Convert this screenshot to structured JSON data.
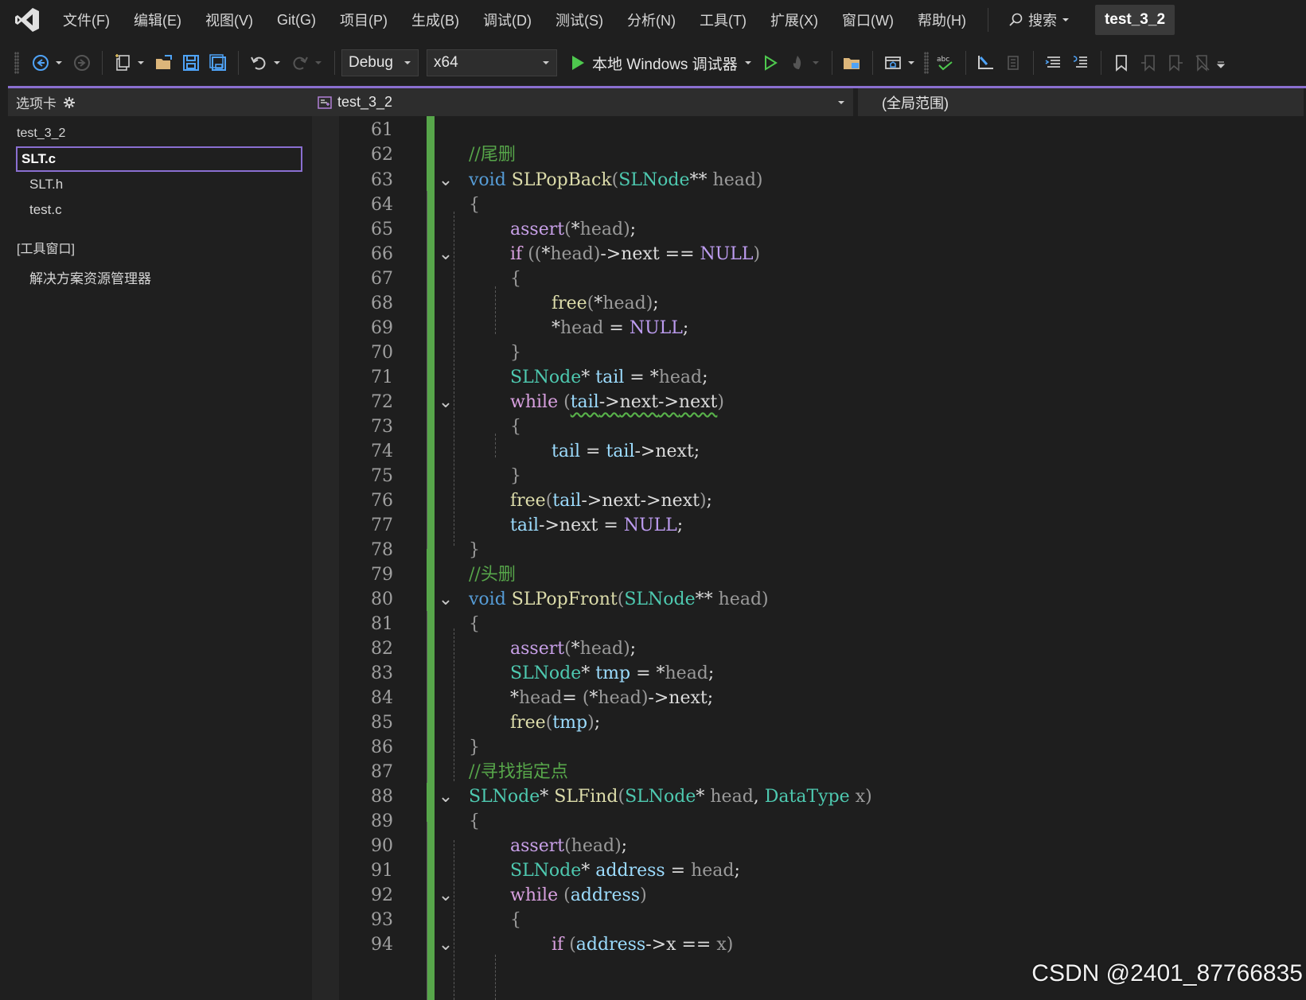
{
  "menubar": {
    "items": [
      "文件(F)",
      "编辑(E)",
      "视图(V)",
      "Git(G)",
      "项目(P)",
      "生成(B)",
      "调试(D)",
      "测试(S)",
      "分析(N)",
      "工具(T)",
      "扩展(X)",
      "窗口(W)",
      "帮助(H)"
    ],
    "search_label": "搜索",
    "solution_name": "test_3_2"
  },
  "toolbar": {
    "configuration": "Debug",
    "platform": "x64",
    "run_label": "本地 Windows 调试器"
  },
  "left_panel": {
    "header": "选项卡",
    "project": "test_3_2",
    "files": [
      "SLT.c",
      "SLT.h",
      "test.c"
    ],
    "selected_file": "SLT.c",
    "tools_group": "[工具窗口]",
    "tools_items": [
      "解决方案资源管理器"
    ]
  },
  "editor": {
    "nav_file": "test_3_2",
    "nav_scope": "(全局范围)",
    "lines": [
      {
        "n": "61",
        "code": ""
      },
      {
        "n": "62",
        "code": "//尾删"
      },
      {
        "n": "63",
        "code": "void SLPopBack(SLNode** head)"
      },
      {
        "n": "64",
        "code": "{"
      },
      {
        "n": "65",
        "code": "assert(*head);"
      },
      {
        "n": "66",
        "code": "if ((*head)->next == NULL)"
      },
      {
        "n": "67",
        "code": "{"
      },
      {
        "n": "68",
        "code": "free(*head);"
      },
      {
        "n": "69",
        "code": "*head = NULL;"
      },
      {
        "n": "70",
        "code": "}"
      },
      {
        "n": "71",
        "code": "SLNode* tail = *head;"
      },
      {
        "n": "72",
        "code": "while (tail->next->next)"
      },
      {
        "n": "73",
        "code": "{"
      },
      {
        "n": "74",
        "code": "tail = tail->next;"
      },
      {
        "n": "75",
        "code": "}"
      },
      {
        "n": "76",
        "code": "free(tail->next->next);"
      },
      {
        "n": "77",
        "code": "tail->next = NULL;"
      },
      {
        "n": "78",
        "code": "}"
      },
      {
        "n": "79",
        "code": "//头删"
      },
      {
        "n": "80",
        "code": "void SLPopFront(SLNode** head)"
      },
      {
        "n": "81",
        "code": "{"
      },
      {
        "n": "82",
        "code": "assert(*head);"
      },
      {
        "n": "83",
        "code": "SLNode* tmp = *head;"
      },
      {
        "n": "84",
        "code": "*head= (*head)->next;"
      },
      {
        "n": "85",
        "code": "free(tmp);"
      },
      {
        "n": "86",
        "code": "}"
      },
      {
        "n": "87",
        "code": "//寻找指定点"
      },
      {
        "n": "88",
        "code": "SLNode* SLFind(SLNode* head, DataType x)"
      },
      {
        "n": "89",
        "code": "{"
      },
      {
        "n": "90",
        "code": "assert(head);"
      },
      {
        "n": "91",
        "code": "SLNode* address = head;"
      },
      {
        "n": "92",
        "code": "while (address)"
      },
      {
        "n": "93",
        "code": "{"
      },
      {
        "n": "94",
        "code": "if (address->x == x)"
      }
    ]
  },
  "watermark": "CSDN @2401_87766835",
  "colors": {
    "accent": "#8a6fd1",
    "change_bar": "#57a64a",
    "keyword": "#569cd6",
    "control": "#d8a0df",
    "type": "#4ec9b0",
    "function": "#dcdcaa",
    "comment": "#57a64a"
  }
}
